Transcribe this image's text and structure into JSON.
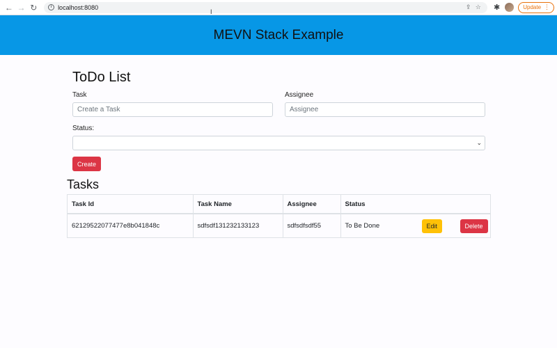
{
  "browser": {
    "url": "localhost:8080",
    "update_label": "Update"
  },
  "header": {
    "title": "MEVN Stack Example"
  },
  "form": {
    "title": "ToDo List",
    "task_label": "Task",
    "task_placeholder": "Create a Task",
    "assignee_label": "Assignee",
    "assignee_placeholder": "Assignee",
    "status_label": "Status:",
    "status_value": "",
    "create_label": "Create"
  },
  "tasks": {
    "title": "Tasks",
    "columns": [
      "Task Id",
      "Task Name",
      "Assignee",
      "Status"
    ],
    "rows": [
      {
        "id": "62129522077477e8b041848c",
        "name": "sdfsdf131232133123",
        "assignee": "sdfsdfsdf55",
        "status": "To Be Done",
        "edit_label": "Edit",
        "delete_label": "Delete"
      }
    ]
  },
  "colors": {
    "header_bg": "#0797e6",
    "danger": "#dc3545",
    "warning": "#ffc107",
    "update_orange": "#e8710a"
  }
}
